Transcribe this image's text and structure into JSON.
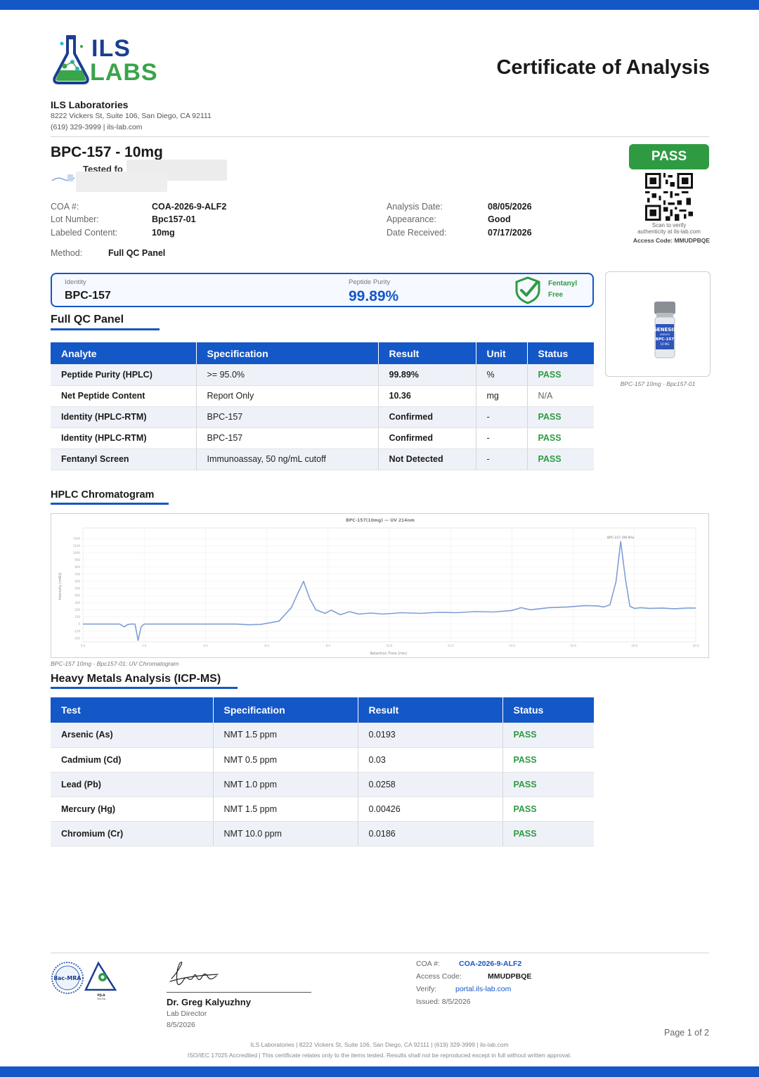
{
  "header": {
    "logo": {
      "line1": "ILS",
      "line2": "LABS"
    },
    "title": "Certificate of Analysis",
    "lab_name": "ILS Laboratories",
    "lab_address": "8222 Vickers St, Suite 106, San Diego, CA 92111",
    "lab_contact": "(619) 329-3999  |  ils-lab.com"
  },
  "product": {
    "name": "BPC-157 - 10mg",
    "tested_for": "Tested fo"
  },
  "meta_left": [
    {
      "label": "COA #:",
      "value": "COA-2026-9-ALF2"
    },
    {
      "label": "Lot Number:",
      "value": "Bpc157-01"
    },
    {
      "label": "Labeled Content:",
      "value": "10mg"
    }
  ],
  "meta_right": [
    {
      "label": "Analysis Date:",
      "value": "08/05/2026"
    },
    {
      "label": "Appearance:",
      "value": "Good"
    },
    {
      "label": "Date Received:",
      "value": "07/17/2026"
    }
  ],
  "method": {
    "label": "Method:",
    "value": "Full QC Panel"
  },
  "verification": {
    "badge": "PASS",
    "scan_line1": "Scan to verify",
    "scan_line2": "authenticity at ils-lab.com",
    "access_code": "Access Code: MMUDPBQE"
  },
  "summary": {
    "identity_label": "Identity",
    "identity_value": "BPC-157",
    "purity_label": "Peptide Purity",
    "purity_value": "99.89%",
    "fentanyl_line1": "Fentanyl",
    "fentanyl_line2": "Free"
  },
  "vial": {
    "brand": "GENESIS",
    "sub": "AMINOS",
    "product": "BPC-157",
    "dose": "10 MG",
    "caption": "BPC-157 10mg - Bpc157-01"
  },
  "qc_panel": {
    "title": "Full QC Panel",
    "columns": [
      "Analyte",
      "Specification",
      "Result",
      "Unit",
      "Status"
    ],
    "rows": [
      [
        "Peptide Purity (HPLC)",
        ">= 95.0%",
        "99.89%",
        "%",
        "PASS"
      ],
      [
        "Net Peptide Content",
        "Report Only",
        "10.36",
        "mg",
        "N/A"
      ],
      [
        "Identity (HPLC-RTM)",
        "BPC-157",
        "Confirmed",
        "-",
        "PASS"
      ],
      [
        "Identity (HPLC-RTM)",
        "BPC-157",
        "Confirmed",
        "-",
        "PASS"
      ],
      [
        "Fentanyl Screen",
        "Immunoassay, 50 ng/mL cutoff",
        "Not Detected",
        "-",
        "PASS"
      ]
    ]
  },
  "chromatogram": {
    "section_title": "HPLC Chromatogram",
    "caption": "BPC-157 10mg - Bpc157-01: UV Chromatogram"
  },
  "chart_data": {
    "type": "line",
    "title": "BPC-157(10mg) — UV 214nm",
    "xlabel": "Retention Time (min)",
    "ylabel": "Intensity (mAU)",
    "xlim": [
      0,
      20
    ],
    "ylim": [
      -250,
      1350
    ],
    "grid": true,
    "peak_label": "BPC-157 (99.9%)",
    "series": [
      {
        "color": "#7f9fd6",
        "x": [
          0,
          1.2,
          1.35,
          1.45,
          1.55,
          1.7,
          1.8,
          1.9,
          2.0,
          2.2,
          2.6,
          3.0,
          4.0,
          5.0,
          5.4,
          5.8,
          6.4,
          6.8,
          7.0,
          7.2,
          7.4,
          7.6,
          7.9,
          8.1,
          8.4,
          8.7,
          9.0,
          9.4,
          9.8,
          10.4,
          11.0,
          11.6,
          12.2,
          12.8,
          13.4,
          14.0,
          14.3,
          14.6,
          15.2,
          15.8,
          16.4,
          16.8,
          17.0,
          17.2,
          17.4,
          17.55,
          17.7,
          17.85,
          18.0,
          18.2,
          18.5,
          18.9,
          19.3,
          19.7,
          20.0
        ],
        "y": [
          0,
          0,
          -40,
          -10,
          0,
          0,
          -230,
          -40,
          0,
          0,
          0,
          0,
          0,
          0,
          -10,
          -5,
          40,
          230,
          420,
          600,
          360,
          200,
          150,
          195,
          130,
          175,
          140,
          155,
          140,
          160,
          150,
          165,
          160,
          175,
          170,
          190,
          230,
          200,
          230,
          240,
          260,
          255,
          240,
          270,
          600,
          1160,
          650,
          250,
          220,
          230,
          220,
          225,
          215,
          225,
          225
        ]
      }
    ]
  },
  "heavy_metals": {
    "title": "Heavy Metals Analysis (ICP-MS)",
    "columns": [
      "Test",
      "Specification",
      "Result",
      "Status"
    ],
    "rows": [
      [
        "Arsenic (As)",
        "NMT 1.5 ppm",
        "0.0193",
        "PASS"
      ],
      [
        "Cadmium (Cd)",
        "NMT 0.5 ppm",
        "0.03",
        "PASS"
      ],
      [
        "Lead (Pb)",
        "NMT 1.0 ppm",
        "0.0258",
        "PASS"
      ],
      [
        "Mercury (Hg)",
        "NMT 1.5 ppm",
        "0.00426",
        "PASS"
      ],
      [
        "Chromium (Cr)",
        "NMT 10.0 ppm",
        "0.0186",
        "PASS"
      ]
    ]
  },
  "footer": {
    "accreditation_1": "ilac-MRA",
    "accreditation_2": "PJLA",
    "accreditation_2_sub": "Testing",
    "signer_name": "Dr. Greg Kalyuzhny",
    "signer_title": "Lab Director",
    "signer_date": "8/5/2026",
    "coa_label": "COA #:",
    "coa_value": "COA-2026-9-ALF2",
    "access_label": "Access Code:",
    "access_value": "MMUDPBQE",
    "verify_label": "Verify:",
    "verify_value": "portal.ils-lab.com",
    "issued": "Issued: 8/5/2026",
    "page": "Page 1 of 2",
    "fine_1": "ILS Laboratories  |  8222 Vickers St, Suite 106, San Diego, CA 92111  |  (619) 329-3999  |  ils-lab.com",
    "fine_2": "ISO/IEC 17025 Accredited  |  This certificate relates only to the items tested. Results shall not be reproduced except in full without written approval."
  },
  "colors": {
    "accent": "#1457c7",
    "pass": "#2e9b42",
    "trace": "#7f9fd6"
  }
}
